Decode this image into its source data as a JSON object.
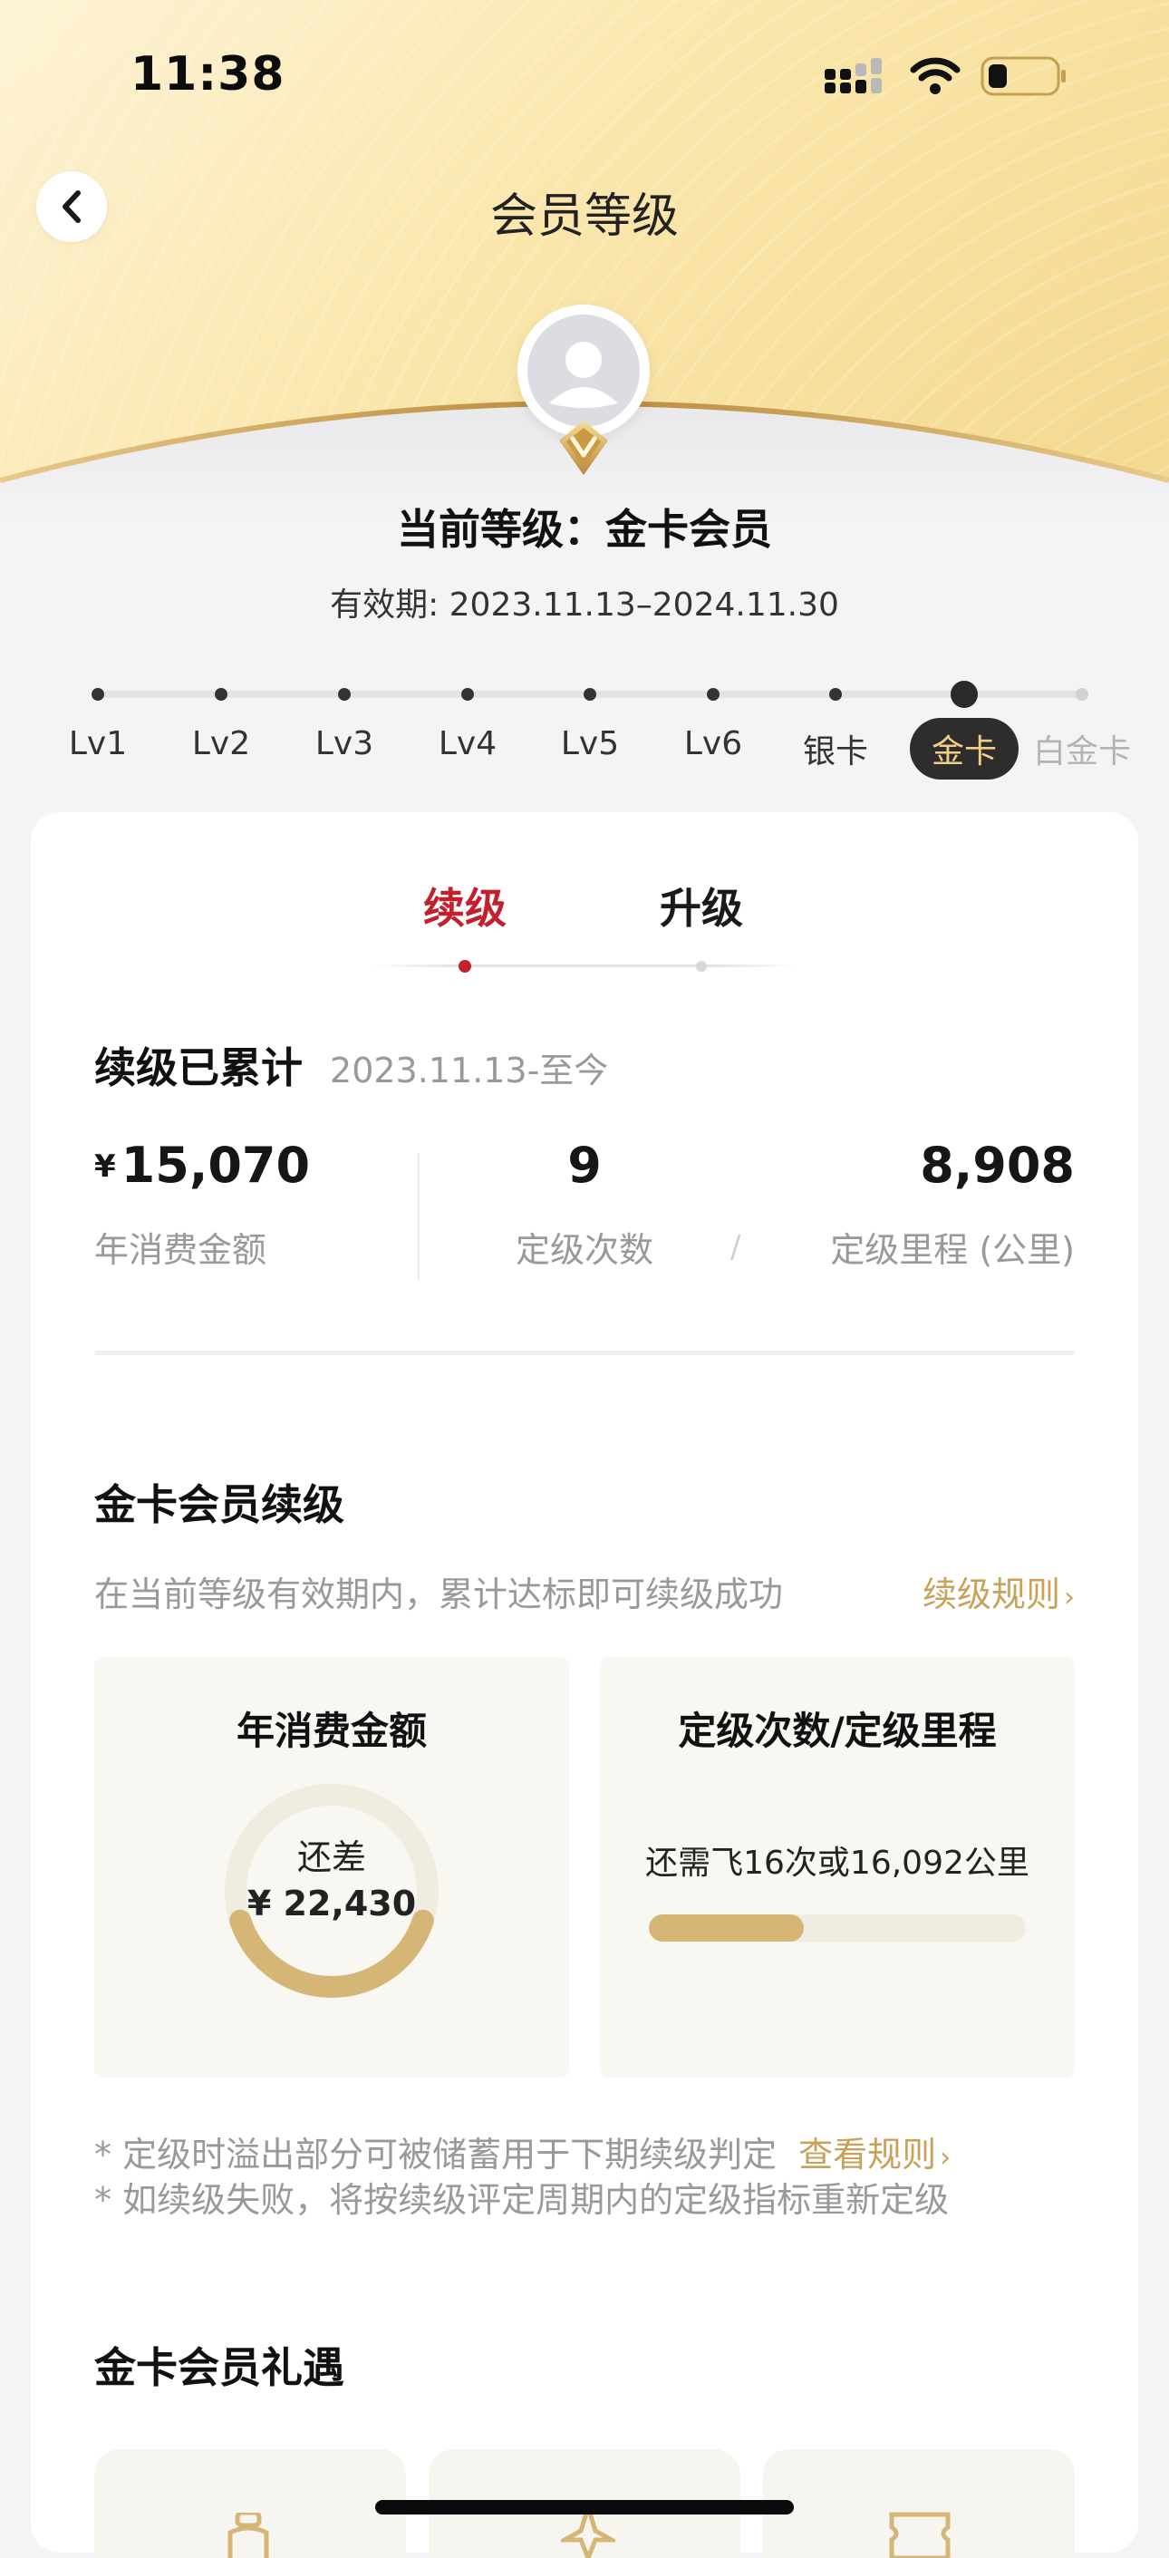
{
  "status_bar": {
    "time": "11:38"
  },
  "header": {
    "title": "会员等级"
  },
  "profile": {
    "level_label": "当前等级：金卡会员",
    "validity": "有效期: 2023.11.13–2024.11.30"
  },
  "levels": [
    {
      "label": "Lv1",
      "state": "done"
    },
    {
      "label": "Lv2",
      "state": "done"
    },
    {
      "label": "Lv3",
      "state": "done"
    },
    {
      "label": "Lv4",
      "state": "done"
    },
    {
      "label": "Lv5",
      "state": "done"
    },
    {
      "label": "Lv6",
      "state": "done"
    },
    {
      "label": "银卡",
      "state": "done"
    },
    {
      "label": "金卡",
      "state": "current"
    },
    {
      "label": "白金卡",
      "state": "future"
    }
  ],
  "tabs": [
    {
      "label": "续级",
      "active": true
    },
    {
      "label": "升级",
      "active": false
    }
  ],
  "accumulated": {
    "title": "续级已累计",
    "since": "2023.11.13-至今",
    "stats": [
      {
        "currency": "¥",
        "value": "15,070",
        "label": "年消费金额"
      },
      {
        "value": "9",
        "label": "定级次数"
      },
      {
        "separator": "/"
      },
      {
        "value": "8,908",
        "label": "定级里程 (公里)"
      }
    ]
  },
  "renewal": {
    "title": "金卡会员续级",
    "desc": "在当前等级有效期内，累计达标即可续级成功",
    "rules_link": "续级规则",
    "rules_arrow": "›",
    "spend_card": {
      "title": "年消费金额",
      "remaining_label": "还差",
      "remaining_value": "¥ 22,430",
      "progress": 0.4
    },
    "flight_card": {
      "title": "定级次数/定级里程",
      "text": "还需飞16次或16,092公里",
      "progress": 0.41
    },
    "notes": [
      "* 定级时溢出部分可被储蓄用于下期续级判定",
      "* 如续级失败，将按续级评定周期内的定级指标重新定级"
    ],
    "notes_link": "查看规则",
    "notes_arrow": "›"
  },
  "benefits": {
    "title": "金卡会员礼遇"
  },
  "colors": {
    "accent_red": "#c3202f",
    "gold": "#c9a25a",
    "gold_ring": "#d6b676",
    "ring_track": "#f1ece0",
    "current_pill_bg": "#2d2d2d",
    "current_pill_text": "#f1cf86"
  },
  "icons": [
    "back-icon",
    "cellular-icon",
    "wifi-icon",
    "battery-icon",
    "avatar-icon",
    "gold-badge-icon"
  ]
}
